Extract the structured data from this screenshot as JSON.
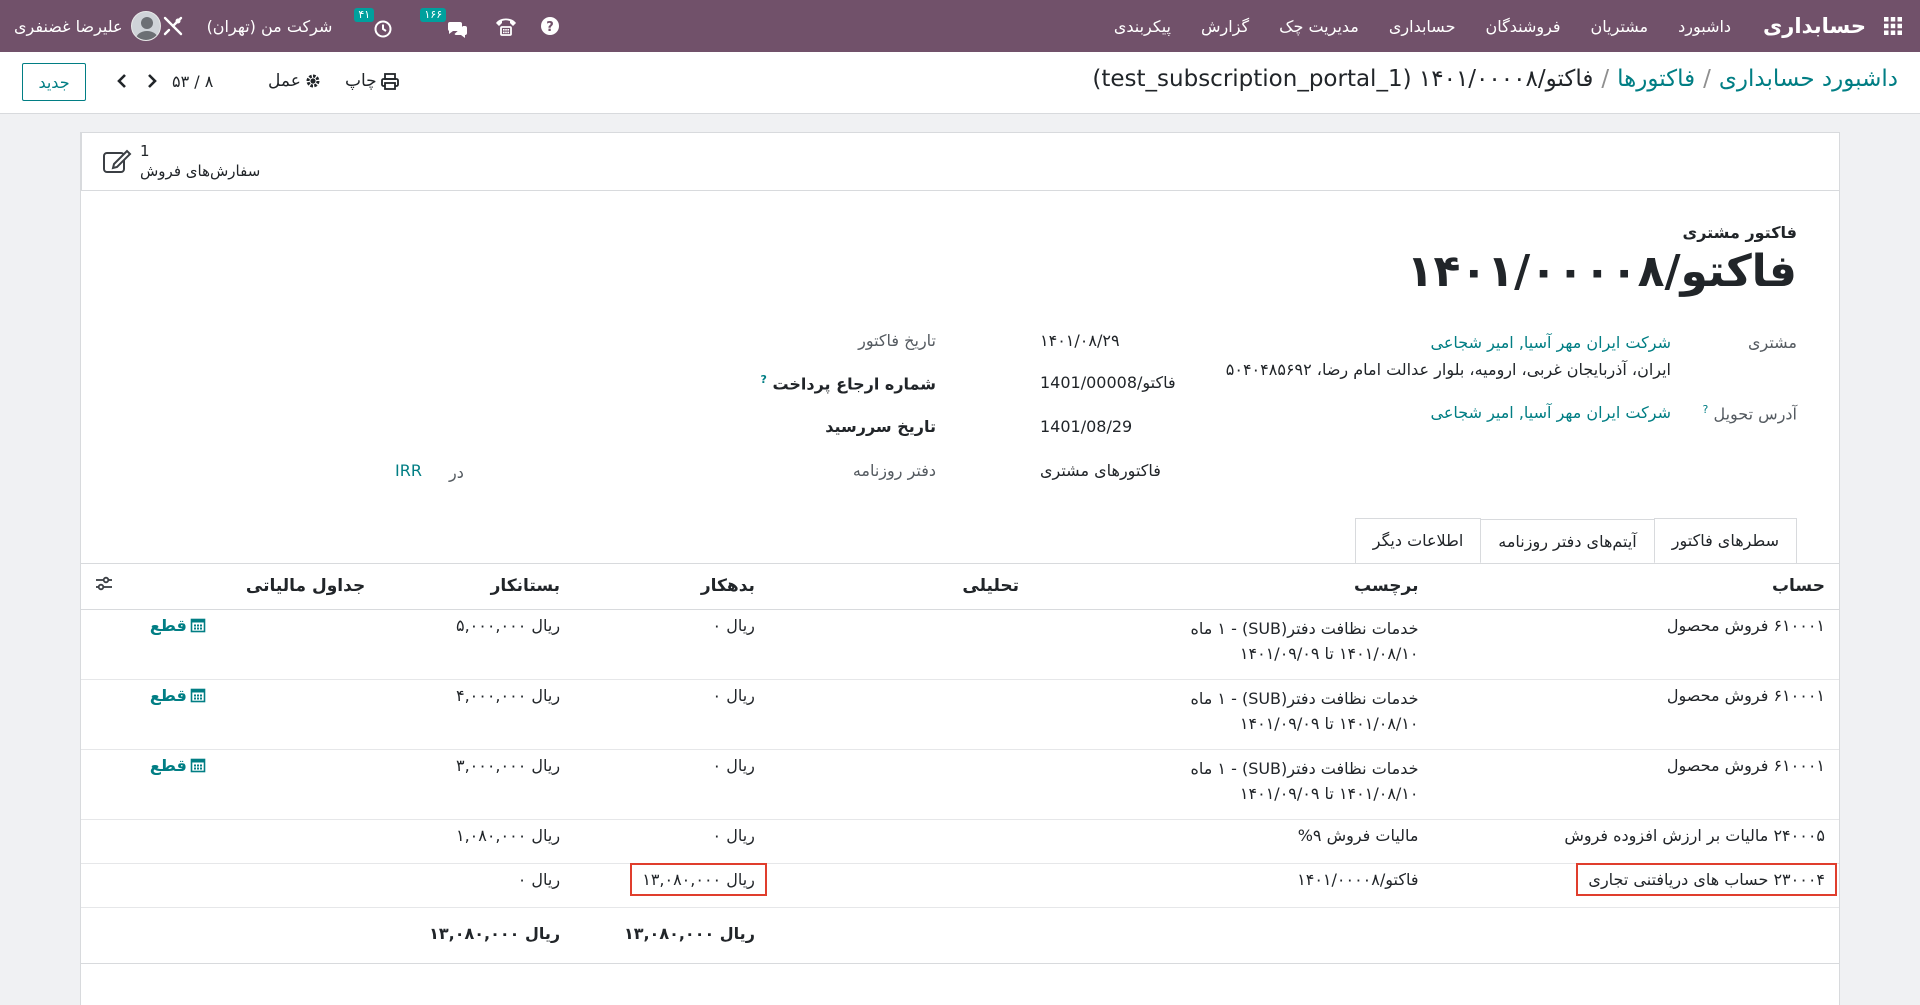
{
  "navbar": {
    "brand": "حسابداری",
    "menu": [
      "داشبورد",
      "مشتریان",
      "فروشندگان",
      "حسابداری",
      "مدیریت چک",
      "گزارش",
      "پیکربندی"
    ],
    "user_name": "علیرضا غضنفری",
    "company": "شرکت من (تهران)",
    "activity_count": "۴۱",
    "messages_count": "۱۶۶"
  },
  "control": {
    "breadcrumb": [
      "داشبورد حسابداری",
      "فاکتورها"
    ],
    "current": "فاکتو/۱۴۰۱/۰۰۰۰۸ (test_subscription_portal_1)",
    "print_label": "چاپ",
    "action_label": "عمل",
    "pager": "۸ / ۵۳",
    "new_label": "جدید"
  },
  "smart_button": {
    "count": "1",
    "label": "سفارش‌های فروش"
  },
  "document": {
    "type": "فاکتور مشتری",
    "title": "فاکتو/۱۴۰۱/۰۰۰۰۸"
  },
  "fields": {
    "customer_label": "مشتری",
    "customer_name": "شرکت ایران مهر آسیا, امیر شجاعی",
    "customer_address": "ایران، آذربایجان غربی، ارومیه، بلوار عدالت امام رضا، ۵۰۴۰۴۸۵۶۹۲",
    "delivery_label": "آدرس تحویل",
    "delivery_value": "شرکت ایران مهر آسیا, امیر شجاعی",
    "invoice_date_label": "تاریخ فاکتور",
    "invoice_date": "۱۴۰۱/۰۸/۲۹",
    "payment_ref_label": "شماره ارجاع پرداخت",
    "payment_ref": "فاکتو/1401/00008",
    "due_date_label": "تاریخ سررسید",
    "due_date": "1401/08/29",
    "journal_label": "دفتر روزنامه",
    "journal": "فاکتورهای مشتری",
    "currency_in": "در",
    "currency": "IRR"
  },
  "tabs": [
    "سطرهای فاکتور",
    "آیتم‌های دفتر روزنامه",
    "اطلاعات دیگر"
  ],
  "table": {
    "headers": {
      "account": "حساب",
      "label": "برچسب",
      "analytic": "تحلیلی",
      "debit": "بدهکار",
      "credit": "بستانکار",
      "tax_grids": "جداول مالیاتی"
    },
    "cut_label": "قطع",
    "rows": [
      {
        "account": "۶۱۰۰۰۱ فروش محصول",
        "label_1": "خدمات نظافت دفتر(SUB) - ۱ ماه",
        "label_2": "۱۴۰۱/۰۸/۱۰ تا ۱۴۰۱/۰۹/۰۹",
        "debit": "ریال ۰",
        "credit": "ریال ۵,۰۰۰,۰۰۰"
      },
      {
        "account": "۶۱۰۰۰۱ فروش محصول",
        "label_1": "خدمات نظافت دفتر(SUB) - ۱ ماه",
        "label_2": "۱۴۰۱/۰۸/۱۰ تا ۱۴۰۱/۰۹/۰۹",
        "debit": "ریال ۰",
        "credit": "ریال ۴,۰۰۰,۰۰۰"
      },
      {
        "account": "۶۱۰۰۰۱ فروش محصول",
        "label_1": "خدمات نظافت دفتر(SUB) - ۱ ماه",
        "label_2": "۱۴۰۱/۰۸/۱۰ تا ۱۴۰۱/۰۹/۰۹",
        "debit": "ریال ۰",
        "credit": "ریال ۳,۰۰۰,۰۰۰"
      },
      {
        "account": "۲۴۰۰۰۵ مالیات بر ارزش افزوده فروش",
        "label": "مالیات فروش ۹%",
        "debit": "ریال ۰",
        "credit": "ریال ۱,۰۸۰,۰۰۰"
      },
      {
        "account": "۲۳۰۰۰۴ حساب های دریافتنی تجاری",
        "label": "فاکتو/۱۴۰۱/۰۰۰۰۸",
        "debit": "ریال ۱۳,۰۸۰,۰۰۰",
        "credit": "ریال ۰"
      }
    ],
    "total_debit": "ریال ۱۳,۰۸۰,۰۰۰",
    "total_credit": "ریال ۱۳,۰۸۰,۰۰۰"
  },
  "colors": {
    "navbar": "#71516a",
    "link": "#017e84",
    "highlight": "#e03e2d",
    "badge": "#00a09d"
  }
}
